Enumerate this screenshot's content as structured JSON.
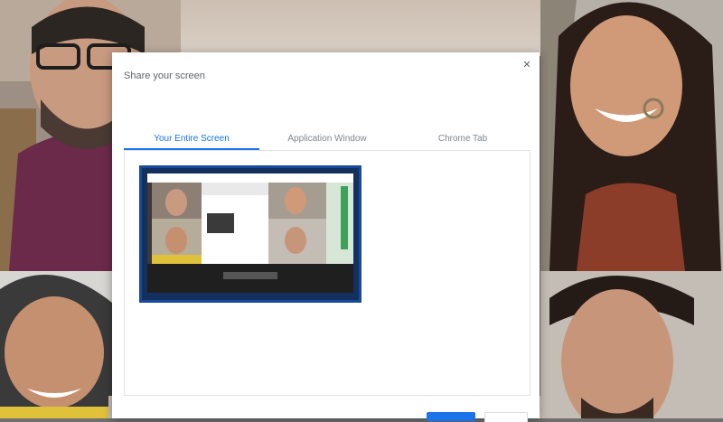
{
  "dialog": {
    "title": "Share your screen",
    "close_icon": "close-icon",
    "tabs": [
      {
        "label": "Your Entire Screen",
        "active": true
      },
      {
        "label": "Application Window",
        "active": false
      },
      {
        "label": "Chrome Tab",
        "active": false
      }
    ],
    "selected_screen_icon": "screen-preview-thumbnail"
  },
  "colors": {
    "accent": "#1a73e8",
    "thumbnail_border": "#1a4a9a"
  }
}
